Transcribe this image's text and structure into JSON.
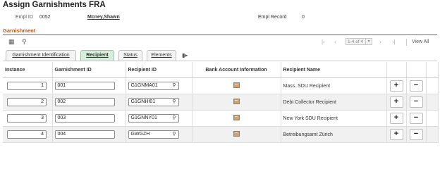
{
  "page": {
    "title": "Assign Garnishments FRA"
  },
  "header": {
    "empl_id_label": "Empl ID",
    "empl_id_value": "0052",
    "name": "Mcney,Shawn",
    "empl_record_label": "Empl Record",
    "empl_record_value": "0"
  },
  "section": {
    "title": "Garnishment"
  },
  "toolbar": {
    "range": "1-4 of 4",
    "view_all": "View All",
    "icons": [
      "personalize-grid-icon",
      "search-icon",
      "first-icon",
      "previous-icon",
      "next-icon",
      "last-icon"
    ]
  },
  "tabs": [
    {
      "label": "Garnishment Identification",
      "active": false
    },
    {
      "label": "Recipient",
      "active": true
    },
    {
      "label": "Status",
      "active": false
    },
    {
      "label": "Elements",
      "active": false
    }
  ],
  "grid": {
    "columns": [
      "Instance",
      "Garnishment ID",
      "Recipient ID",
      "Bank Account Information",
      "Recipient Name"
    ],
    "rows": [
      {
        "instance": "1",
        "garnishment_id": "001",
        "recipient_id": "G1GNMA01",
        "recipient_name": "Mass. SDU Recipient"
      },
      {
        "instance": "2",
        "garnishment_id": "002",
        "recipient_id": "G1GNHI01",
        "recipient_name": "Debt Collector Recipient"
      },
      {
        "instance": "3",
        "garnishment_id": "003",
        "recipient_id": "G1GNNY01",
        "recipient_name": "New York SDU Recipient"
      },
      {
        "instance": "4",
        "garnishment_id": "004",
        "recipient_id": "GWGZH",
        "recipient_name": "Betreibungsamt Zürich"
      }
    ],
    "add_label": "+",
    "delete_label": "−"
  }
}
